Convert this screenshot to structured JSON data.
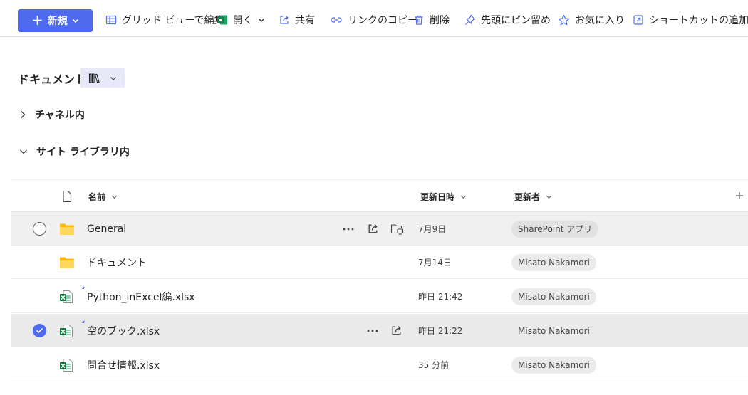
{
  "toolbar": {
    "new_label": "新規",
    "items": [
      {
        "label": "グリッド ビューで編集"
      },
      {
        "label": "開く"
      },
      {
        "label": "共有"
      },
      {
        "label": "リンクのコピー"
      },
      {
        "label": "削除"
      },
      {
        "label": "先頭にピン留め"
      },
      {
        "label": "お気に入り"
      },
      {
        "label": "ショートカットの追加"
      }
    ],
    "colors": {
      "accent": "#4f6bed",
      "excel": "#107c41",
      "folder": "#ffb900"
    }
  },
  "library": {
    "title": "ドキュメント",
    "groups": [
      {
        "label": "チャネル内",
        "expanded": false
      },
      {
        "label": "サイト ライブラリ内",
        "expanded": true
      }
    ]
  },
  "list": {
    "columns": {
      "name": "名前",
      "modified": "更新日時",
      "modified_by": "更新者"
    },
    "rows": [
      {
        "icon": "folder-icon",
        "name": "General",
        "modified": "7月9日",
        "modified_by": "SharePoint アプリ",
        "state": "hover"
      },
      {
        "icon": "folder-icon",
        "name": "ドキュメント",
        "modified": "7月14日",
        "modified_by": "Misato Nakamori",
        "state": "normal"
      },
      {
        "icon": "excel-icon",
        "name": "Python_inExcel編.xlsx",
        "modified": "昨日 21:42",
        "modified_by": "Misato Nakamori",
        "state": "normal",
        "new": true
      },
      {
        "icon": "excel-icon",
        "name": "空のブック.xlsx",
        "modified": "昨日 21:22",
        "modified_by": "Misato Nakamori",
        "state": "selected",
        "new": true
      },
      {
        "icon": "excel-icon",
        "name": "問合せ情報.xlsx",
        "modified": "35 分前",
        "modified_by": "Misato Nakamori",
        "state": "normal"
      }
    ]
  }
}
